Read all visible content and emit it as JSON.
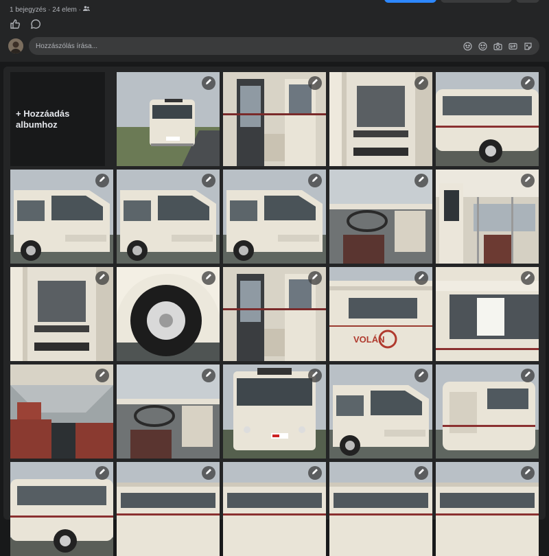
{
  "post": {
    "meta_text": "1 bejegyzés · 24 elem ·",
    "privacy_icon": "people-icon"
  },
  "actions": {
    "like_icon": "thumbs-up-icon",
    "comment_icon": "comment-bubble-icon"
  },
  "comment": {
    "placeholder": "Hozzászólás írása...",
    "icons": [
      "avatar-sticker-icon",
      "emoji-icon",
      "camera-icon",
      "gif-icon",
      "sticker-icon"
    ]
  },
  "album": {
    "add_label": "+ Hozzáadás albumhoz",
    "photos": [
      {
        "subject": "bus-front-road"
      },
      {
        "subject": "bus-door-interior"
      },
      {
        "subject": "bus-steps"
      },
      {
        "subject": "bus-side"
      },
      {
        "subject": "bus-front-angle"
      },
      {
        "subject": "bus-front-angle"
      },
      {
        "subject": "bus-side-angle"
      },
      {
        "subject": "driver-cabin"
      },
      {
        "subject": "interior-ceiling"
      },
      {
        "subject": "door-steps"
      },
      {
        "subject": "wheel"
      },
      {
        "subject": "bus-door-side"
      },
      {
        "subject": "volan-logo"
      },
      {
        "subject": "window-notice"
      },
      {
        "subject": "interior-seats"
      },
      {
        "subject": "dashboard"
      },
      {
        "subject": "bus-front"
      },
      {
        "subject": "bus-front-angle"
      },
      {
        "subject": "bus-rear"
      },
      {
        "subject": "bus-side"
      },
      {
        "subject": "bus-roof"
      },
      {
        "subject": "bus-roof"
      },
      {
        "subject": "bus-roof"
      },
      {
        "subject": "bus-roof"
      }
    ]
  },
  "colors": {
    "bg": "#18191a",
    "panel": "#242526",
    "input": "#3a3b3c",
    "text_muted": "#b0b3b8"
  }
}
